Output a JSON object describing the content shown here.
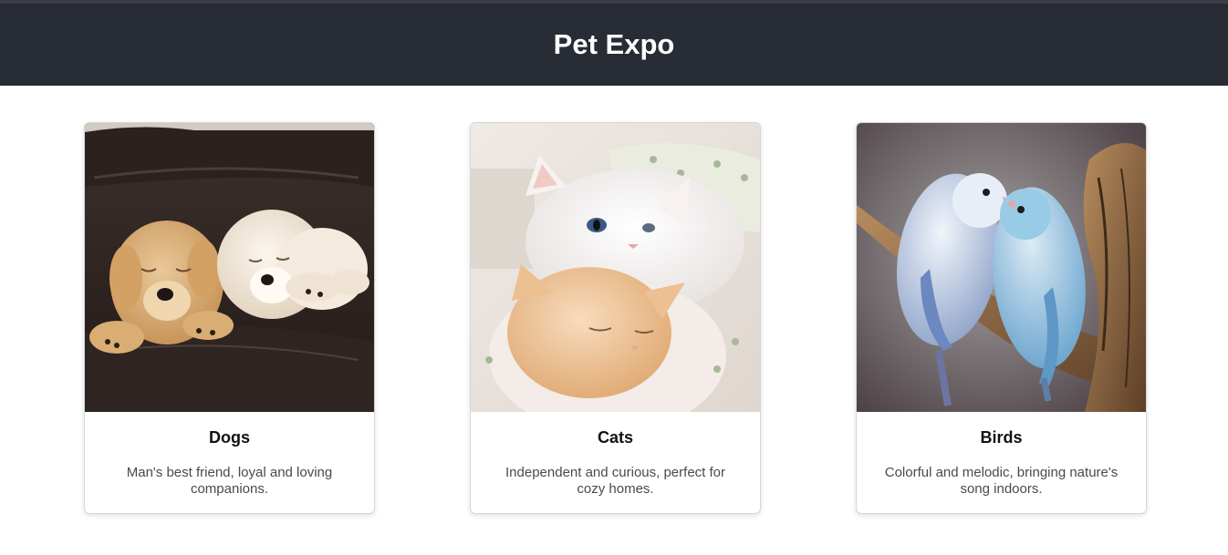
{
  "header": {
    "title": "Pet Expo"
  },
  "cards": [
    {
      "title": "Dogs",
      "description": "Man's best friend, loyal and loving companions.",
      "image": "two-sleeping-puppies-on-leather-couch"
    },
    {
      "title": "Cats",
      "description": "Independent and curious, perfect for cozy homes.",
      "image": "white-and-orange-cats-cuddling"
    },
    {
      "title": "Birds",
      "description": "Colorful and melodic, bringing nature's song indoors.",
      "image": "two-blue-parrotlets-on-branch"
    }
  ],
  "colors": {
    "header_bg": "#282c35",
    "header_text": "#ffffff",
    "card_border": "#d6d6d6",
    "description_text": "#4a4a4a"
  }
}
